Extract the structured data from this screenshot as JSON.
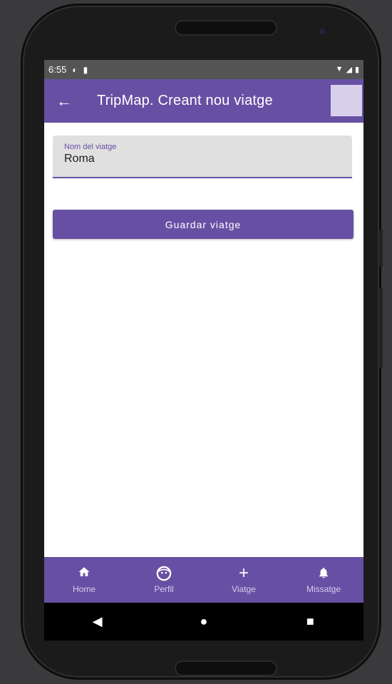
{
  "status": {
    "time": "6:55",
    "icons": [
      "sync-icon",
      "sim-icon",
      "wifi-icon",
      "signal-icon",
      "battery-icon"
    ]
  },
  "appbar": {
    "title": "TripMap. Creant nou viatge",
    "back_icon": "arrow-left-icon",
    "avatar_color": "#d8d0ea"
  },
  "form": {
    "trip_name_label": "Nom del viatge",
    "trip_name_value": "Roma",
    "save_label": "Guardar viatge"
  },
  "bottom_nav": {
    "items": [
      {
        "label": "Home",
        "icon": "home-icon"
      },
      {
        "label": "Perfil",
        "icon": "face-icon"
      },
      {
        "label": "Viatge",
        "icon": "plus-icon"
      },
      {
        "label": "Missatge",
        "icon": "bell-icon"
      }
    ]
  },
  "colors": {
    "primary": "#6750a4",
    "statusbar": "#545454",
    "field_bg": "#e0e0e0"
  }
}
